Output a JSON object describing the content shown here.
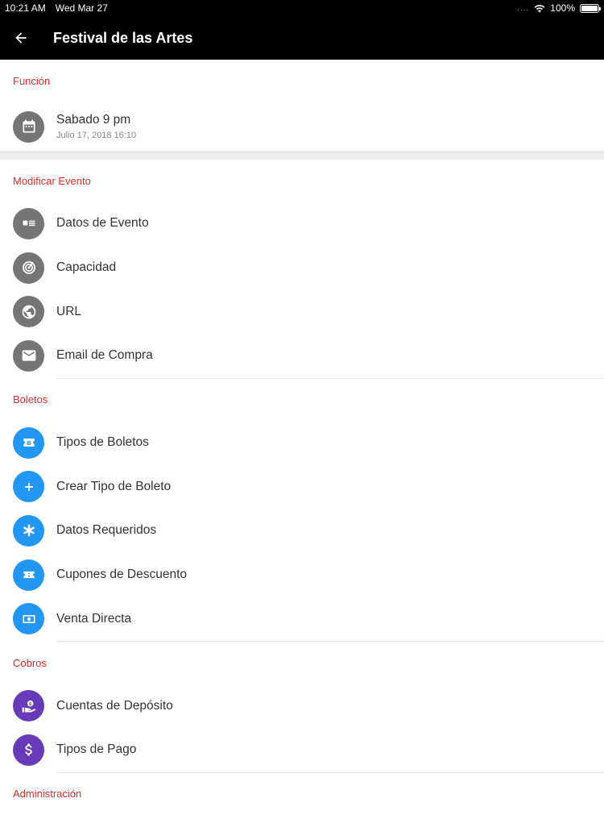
{
  "status_bar": {
    "time": "10:21 AM",
    "date": "Wed Mar 27",
    "signal": "....",
    "battery": "100%"
  },
  "app_bar": {
    "title": "Festival de las Artes",
    "back_icon": "arrow-back-icon"
  },
  "funcion": {
    "header": "Función",
    "item": {
      "title": "Sabado 9 pm",
      "subtitle": "Julio 17, 2018 16:10",
      "icon": "calendar-icon"
    }
  },
  "modificar": {
    "header": "Modificar Evento",
    "items": [
      {
        "label": "Datos de Evento",
        "icon": "event-details-icon"
      },
      {
        "label": "Capacidad",
        "icon": "capacity-icon"
      },
      {
        "label": "URL",
        "icon": "globe-icon"
      },
      {
        "label": "Email de Compra",
        "icon": "email-icon"
      }
    ]
  },
  "boletos": {
    "header": "Boletos",
    "items": [
      {
        "label": "Tipos de Boletos",
        "icon": "ticket-icon"
      },
      {
        "label": "Crear Tipo de Boleto",
        "icon": "plus-icon"
      },
      {
        "label": "Datos Requeridos",
        "icon": "asterisk-icon"
      },
      {
        "label": "Cupones de Descuento",
        "icon": "coupon-icon"
      },
      {
        "label": "Venta Directa",
        "icon": "cash-icon"
      }
    ]
  },
  "cobros": {
    "header": "Cobros",
    "items": [
      {
        "label": "Cuentas de Depósito",
        "icon": "deposit-icon"
      },
      {
        "label": "Tipos de Pago",
        "icon": "dollar-icon"
      }
    ]
  },
  "administracion": {
    "header": "Administración"
  },
  "colors": {
    "section_header": "#e32a2a",
    "icon_gray": "#757575",
    "icon_blue": "#2196f3",
    "icon_purple": "#673ab7"
  }
}
